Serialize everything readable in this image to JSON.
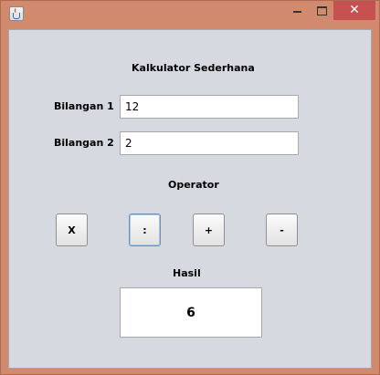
{
  "window": {
    "close_glyph": "✕"
  },
  "form": {
    "title": "Kalkulator Sederhana",
    "label_1": "Bilangan 1",
    "value_1": "12",
    "label_2": "Bilangan 2",
    "value_2": "2",
    "operator_label": "Operator",
    "buttons": {
      "multiply": "X",
      "divide": ":",
      "add": "+",
      "subtract": "-"
    },
    "result_label": "Hasil",
    "result_value": "6"
  }
}
